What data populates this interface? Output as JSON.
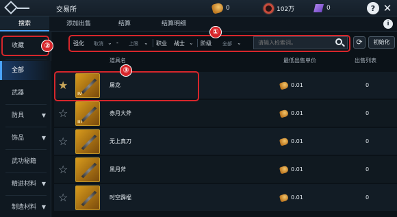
{
  "header": {
    "title": "交易所",
    "currencies": [
      {
        "icon": "gold-coin-icon",
        "value": "0"
      },
      {
        "icon": "red-ring-icon",
        "value": "102万"
      },
      {
        "icon": "purple-gem-icon",
        "value": "0"
      }
    ],
    "help_label": "?",
    "close_label": "✕"
  },
  "tabs": [
    {
      "label": "搜索",
      "active": true
    },
    {
      "label": "添加出售"
    },
    {
      "label": "结算"
    },
    {
      "label": "结算明细"
    }
  ],
  "info_label": "i",
  "sidebar": {
    "items": [
      {
        "label": "收藏"
      },
      {
        "label": "全部",
        "active": true
      },
      {
        "label": "武器"
      },
      {
        "label": "防具",
        "expandable": true
      },
      {
        "label": "饰品",
        "expandable": true
      },
      {
        "label": "武功秘籍"
      },
      {
        "label": "精进材料",
        "expandable": true
      },
      {
        "label": "制造材料",
        "expandable": true
      }
    ]
  },
  "filters": {
    "enhance_label": "强化",
    "enhance_min": "取消",
    "range_dash": "-",
    "enhance_max": "上限",
    "job_label": "职业",
    "job_value": "战士",
    "tier_label": "阶级",
    "tier_value": "全部",
    "search_placeholder": "请输入检索词。",
    "refresh_label": "⟳",
    "reset_label": "初始化"
  },
  "table": {
    "headers": {
      "name": "道具名",
      "price": "最低出售单价",
      "list": "出售列表"
    },
    "rows": [
      {
        "favorited": true,
        "grade": "IV",
        "name": "屠龙",
        "price": "0.01",
        "count": "0"
      },
      {
        "favorited": false,
        "grade": "III",
        "name": "赤月大斧",
        "price": "0.01",
        "count": "0"
      },
      {
        "favorited": false,
        "grade": "",
        "name": "无上真刀",
        "price": "0.01",
        "count": "0"
      },
      {
        "favorited": false,
        "grade": "",
        "name": "黑月斧",
        "price": "0.01",
        "count": "0"
      },
      {
        "favorited": false,
        "grade": "",
        "name": "时空霹棍",
        "price": "0.01",
        "count": "0"
      }
    ]
  },
  "annotations": [
    "①",
    "②",
    "③"
  ],
  "colors": {
    "accent": "#4aa3ff",
    "annotation": "#d7262b",
    "gold": "#c9a65a"
  }
}
